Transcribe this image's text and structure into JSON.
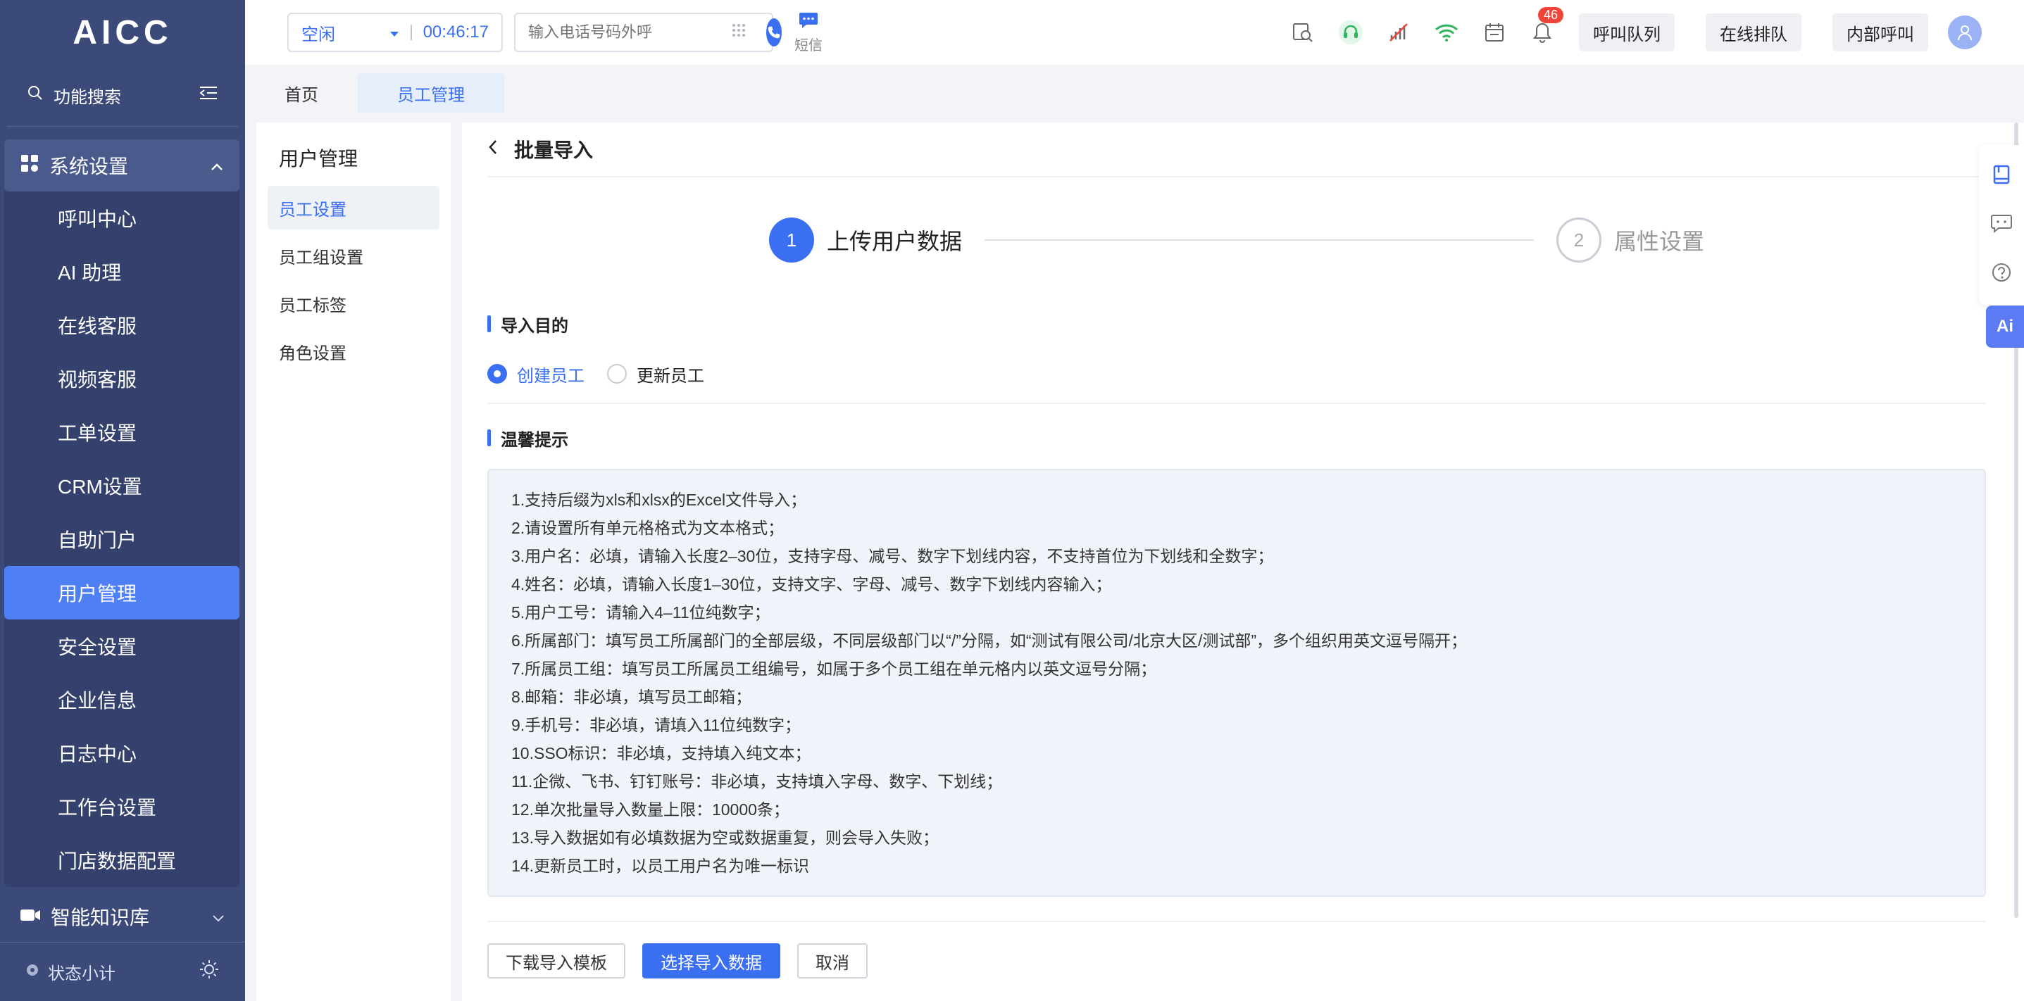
{
  "brand": "AICC",
  "sidebar": {
    "search_label": "功能搜索",
    "group_label": "系统设置",
    "items": [
      {
        "label": "呼叫中心"
      },
      {
        "label": "AI 助理"
      },
      {
        "label": "在线客服"
      },
      {
        "label": "视频客服"
      },
      {
        "label": "工单设置"
      },
      {
        "label": "CRM设置"
      },
      {
        "label": "自助门户"
      },
      {
        "label": "用户管理"
      },
      {
        "label": "安全设置"
      },
      {
        "label": "企业信息"
      },
      {
        "label": "日志中心"
      },
      {
        "label": "工作台设置"
      },
      {
        "label": "门店数据配置"
      }
    ],
    "group2_label": "智能知识库",
    "footer_label": "状态小计"
  },
  "topbar": {
    "status": "空闲",
    "timer": "00:46:17",
    "dial_placeholder": "输入电话号码外呼",
    "sms_label": "短信",
    "notif_count": "46",
    "btn_queue": "呼叫队列",
    "btn_online": "在线排队",
    "btn_internal": "内部呼叫"
  },
  "tabs": [
    {
      "label": "首页"
    },
    {
      "label": "员工管理"
    }
  ],
  "subnav": {
    "title": "用户管理",
    "items": [
      {
        "label": "员工设置"
      },
      {
        "label": "员工组设置"
      },
      {
        "label": "员工标签"
      },
      {
        "label": "角色设置"
      }
    ]
  },
  "page": {
    "title": "批量导入",
    "step1_num": "1",
    "step1_label": "上传用户数据",
    "step2_num": "2",
    "step2_label": "属性设置",
    "purpose_title": "导入目的",
    "radio_create": "创建员工",
    "radio_update": "更新员工",
    "tips_title": "温馨提示",
    "tips": [
      "1.支持后缀为xls和xlsx的Excel文件导入；",
      "2.请设置所有单元格格式为文本格式；",
      "3.用户名：必填，请输入长度2–30位，支持字母、减号、数字下划线内容，不支持首位为下划线和全数字；",
      "4.姓名：必填，请输入长度1–30位，支持文字、字母、减号、数字下划线内容输入；",
      "5.用户工号：请输入4–11位纯数字；",
      "6.所属部门：填写员工所属部门的全部层级，不同层级部门以“/”分隔，如“测试有限公司/北京大区/测试部”，多个组织用英文逗号隔开；",
      "7.所属员工组：填写员工所属员工组编号，如属于多个员工组在单元格内以英文逗号分隔；",
      "8.邮箱：非必填，填写员工邮箱；",
      "9.手机号：非必填，请填入11位纯数字；",
      "10.SSO标识：非必填，支持填入纯文本；",
      "11.企微、飞书、钉钉账号：非必填，支持填入字母、数字、下划线；",
      "12.单次批量导入数量上限：10000条；",
      "13.导入数据如有必填数据为空或数据重复，则会导入失败；",
      "14.更新员工时，以员工用户名为唯一标识"
    ],
    "btn_download": "下载导入模板",
    "btn_select": "选择导入数据",
    "btn_cancel": "取消"
  },
  "ai_label": "Ai"
}
